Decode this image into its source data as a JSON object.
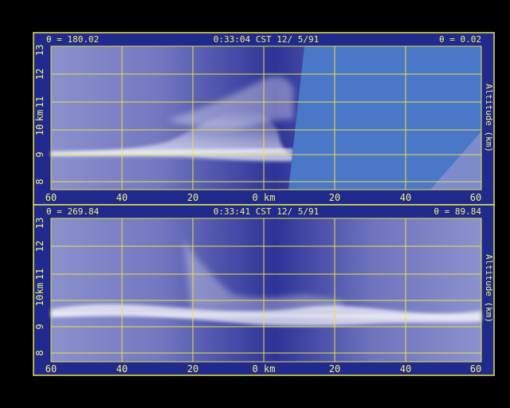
{
  "colors": {
    "background": "#000000",
    "frame": "#1f2a8c",
    "grid": "#e8e24a",
    "label": "#f2ee7a",
    "plot_light": "#8a8fcc",
    "plot_dark": "#2b3196",
    "overlay_blue": "#4a77c8",
    "cloud": "#ffffff"
  },
  "panels": [
    {
      "id": "upper",
      "theta_left": "θ = 180.02",
      "time": "0:33:04 CST 12/ 5/91",
      "theta_right": "θ = 0.02",
      "ylabel": "Altitude (km)",
      "y_axis_unit": "km",
      "y_ticks": [
        "8",
        "9",
        "10",
        "11",
        "12",
        "13"
      ],
      "x_ticks": [
        "60",
        "40",
        "20",
        "0 km",
        "20",
        "40",
        "60"
      ],
      "overlay": true,
      "cloud_layer_km": 9.2
    },
    {
      "id": "lower",
      "theta_left": "θ = 269.84",
      "time": "0:33:41 CST 12/ 5/91",
      "theta_right": "θ = 89.84",
      "ylabel": "Altitude (km)",
      "y_axis_unit": "km",
      "y_ticks": [
        "8",
        "9",
        "10",
        "11",
        "12",
        "13"
      ],
      "x_ticks": [
        "60",
        "40",
        "20",
        "0 km",
        "20",
        "40",
        "60"
      ],
      "overlay": false,
      "cloud_layer_km": 9.5
    }
  ]
}
